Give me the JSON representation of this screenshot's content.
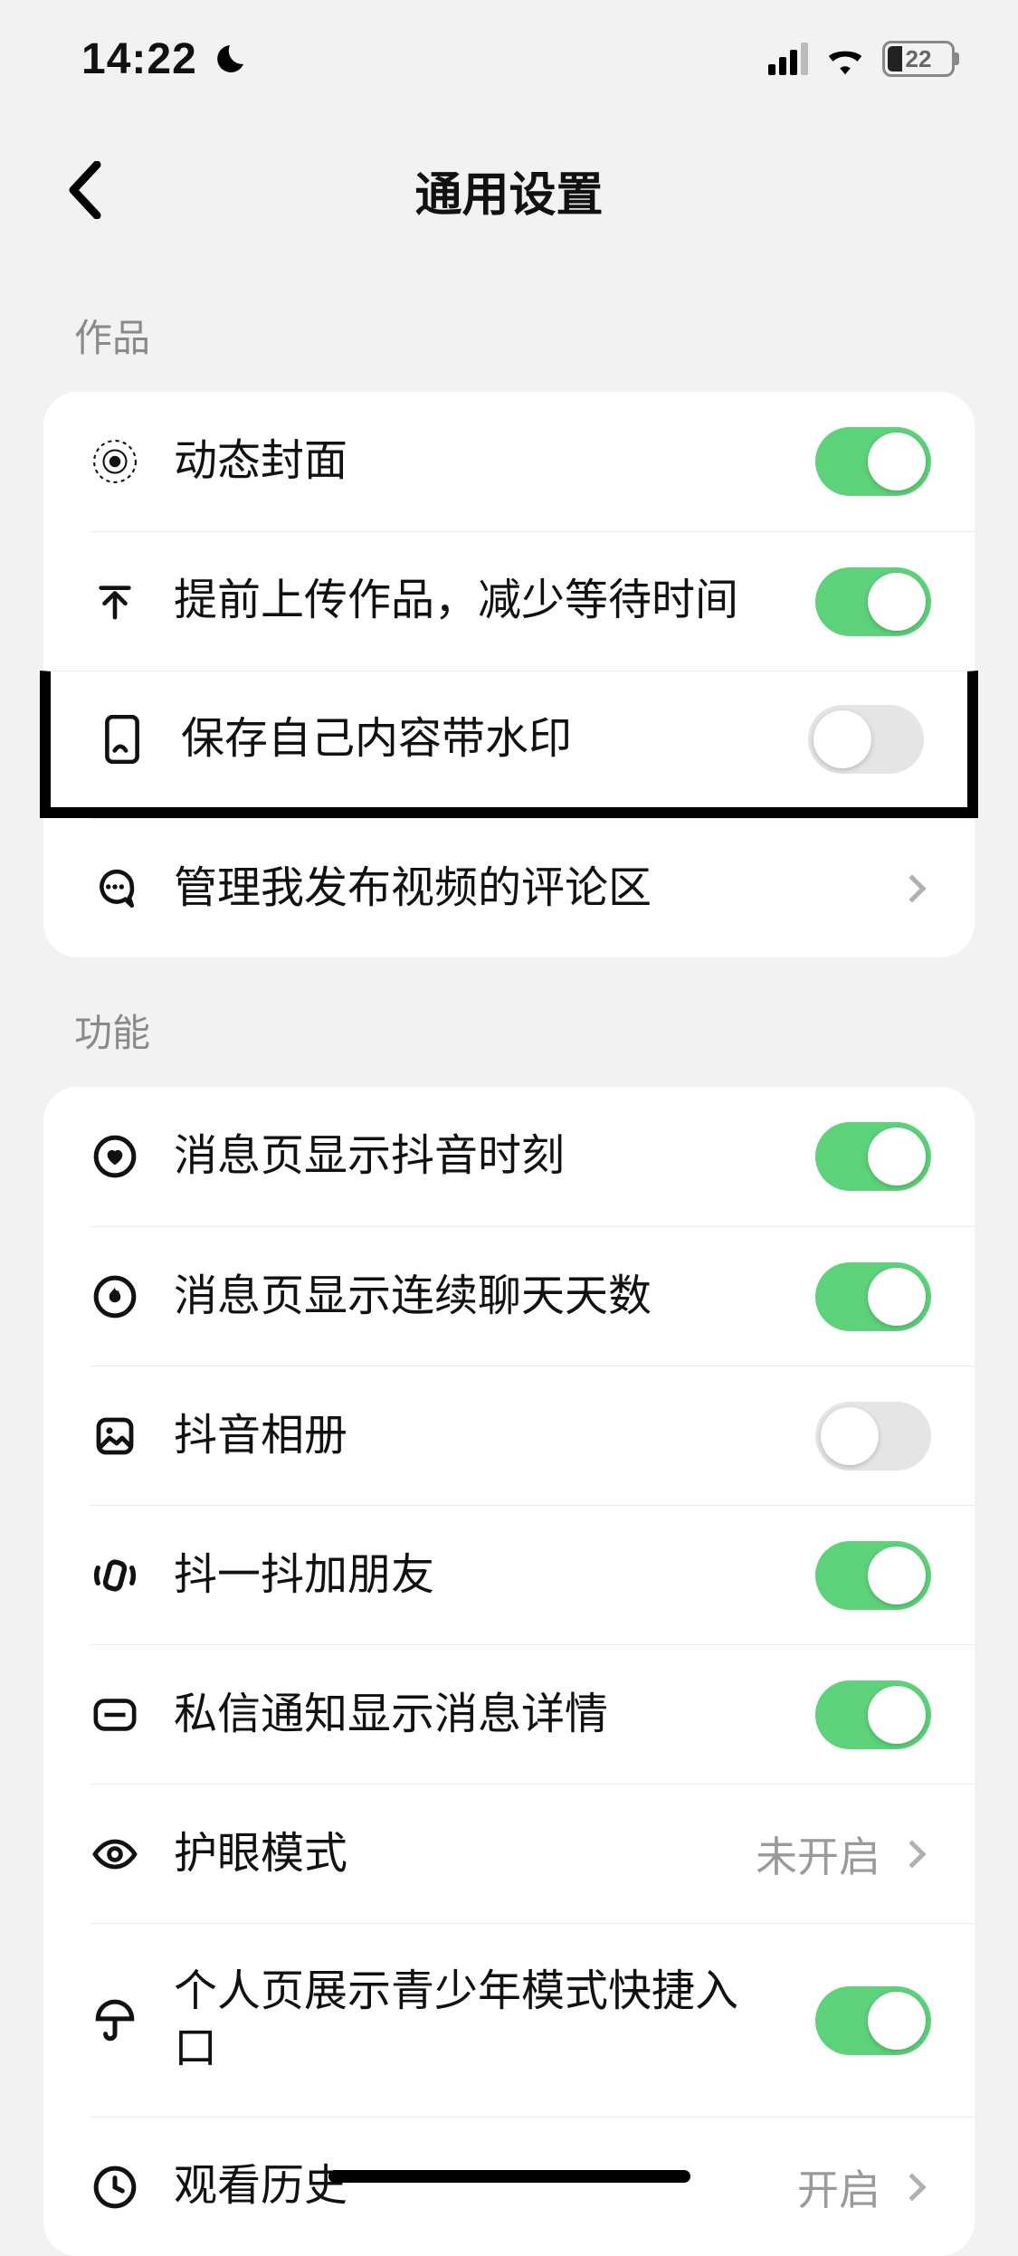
{
  "status": {
    "time": "14:22",
    "battery_pct": "22"
  },
  "nav": {
    "title": "通用设置"
  },
  "sections": {
    "works": {
      "label": "作品",
      "items": {
        "dynamic_cover": {
          "label": "动态封面",
          "on": true
        },
        "pre_upload": {
          "label": "提前上传作品，减少等待时间",
          "on": true
        },
        "save_watermark": {
          "label": "保存自己内容带水印",
          "on": false
        },
        "manage_comments": {
          "label": "管理我发布视频的评论区"
        }
      }
    },
    "features": {
      "label": "功能",
      "items": {
        "show_moments": {
          "label": "消息页显示抖音时刻",
          "on": true
        },
        "show_chat_streak": {
          "label": "消息页显示连续聊天天数",
          "on": true
        },
        "douyin_album": {
          "label": "抖音相册",
          "on": false
        },
        "shake_friends": {
          "label": "抖一抖加朋友",
          "on": true
        },
        "dm_detail": {
          "label": "私信通知显示消息详情",
          "on": true
        },
        "eye_care": {
          "label": "护眼模式",
          "value": "未开启"
        },
        "teen_shortcut": {
          "label": "个人页展示青少年模式快捷入口",
          "on": true
        },
        "watch_history": {
          "label": "观看历史",
          "value": "开启"
        }
      }
    }
  },
  "colors": {
    "accent": "#5dd27a"
  }
}
